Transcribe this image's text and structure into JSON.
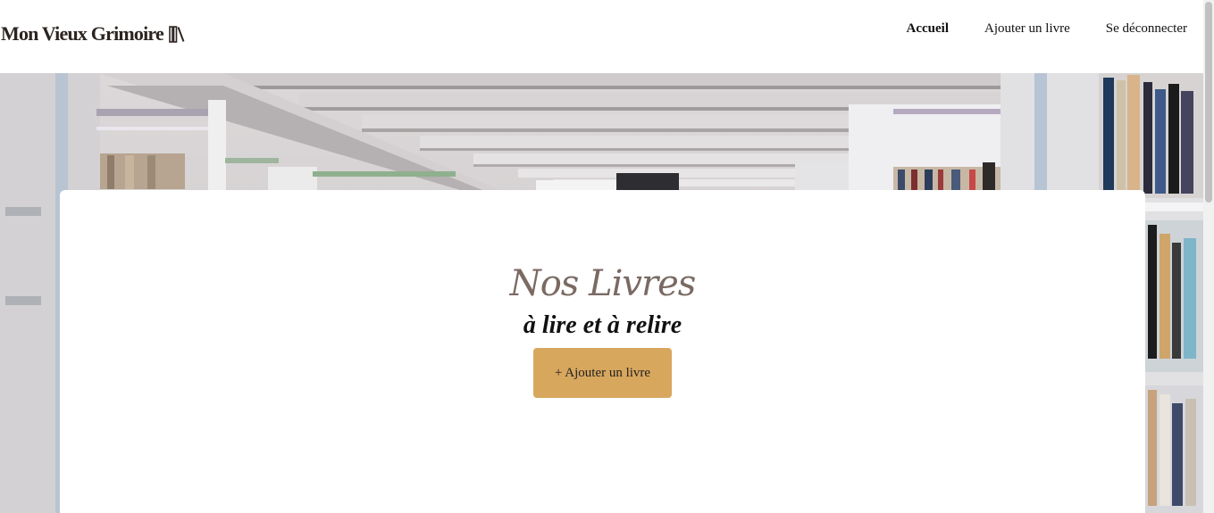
{
  "header": {
    "logo_text": "Mon Vieux Grimoire",
    "logo_icon": "books-icon",
    "nav": [
      {
        "label": "Accueil",
        "active": true
      },
      {
        "label": "Ajouter un livre",
        "active": false
      },
      {
        "label": "Se déconnecter",
        "active": false
      }
    ]
  },
  "hero": {
    "image": "library-shelves-photo"
  },
  "main": {
    "title": "Nos Livres",
    "subtitle": "à lire et à relire",
    "add_button_label": "+ Ajouter un livre"
  },
  "colors": {
    "accent": "#d8a75e",
    "title": "#7a6a63",
    "text": "#111111"
  }
}
